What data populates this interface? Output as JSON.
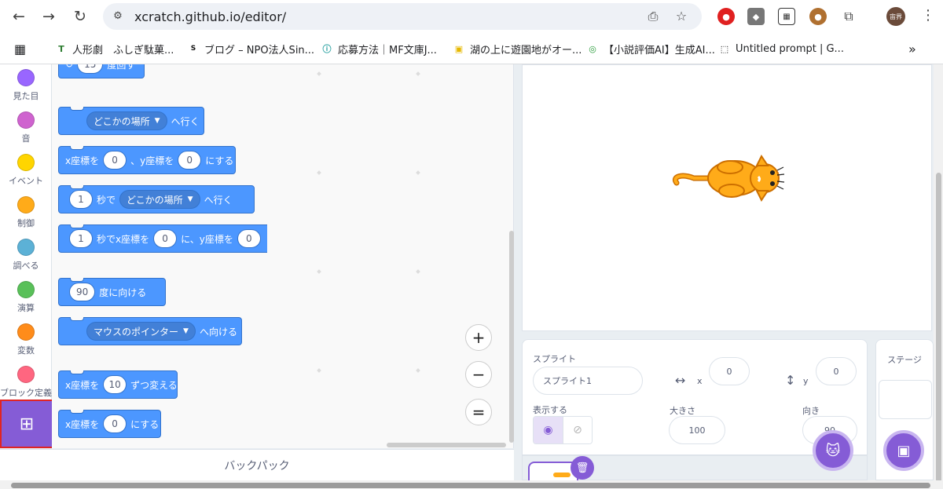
{
  "browser": {
    "url": "xcratch.github.io/editor/",
    "bookmarks": [
      {
        "label": "人形劇　ふしぎ駄菓...",
        "icon": "T"
      },
      {
        "label": "ブログ – NPO法人Sin...",
        "icon": "S"
      },
      {
        "label": "応募方法｜MF文庫J...",
        "icon": "ⓘ"
      },
      {
        "label": "湖の上に遊園地がオー...",
        "icon": "▣"
      },
      {
        "label": "【小説評価AI】生成AI...",
        "icon": "◎"
      },
      {
        "label": "Untitled prompt | G...",
        "icon": "⬚"
      }
    ],
    "more": "»",
    "avatar": "宙界"
  },
  "categories": [
    {
      "label": "見た目",
      "color": "#9966ff"
    },
    {
      "label": "音",
      "color": "#cf63cf"
    },
    {
      "label": "イベント",
      "color": "#ffd500"
    },
    {
      "label": "制御",
      "color": "#ffab19"
    },
    {
      "label": "調べる",
      "color": "#5cb1d6"
    },
    {
      "label": "演算",
      "color": "#59c059"
    },
    {
      "label": "変数",
      "color": "#ff8c1a"
    },
    {
      "label": "ブロック定義",
      "color": "#ff6680"
    }
  ],
  "blocks": {
    "b0": {
      "value": "15",
      "text": "度回す"
    },
    "b1": {
      "dd": "どこかの場所",
      "text": "へ行く"
    },
    "b2": {
      "t1": "x座標を",
      "v1": "0",
      "t2": "、y座標を",
      "v2": "0",
      "t3": "にする"
    },
    "b3": {
      "v1": "1",
      "t1": "秒で",
      "dd": "どこかの場所",
      "t2": "へ行く"
    },
    "b4": {
      "v1": "1",
      "t1": "秒でx座標を",
      "v2": "0",
      "t2": "に、y座標を",
      "v3": "0"
    },
    "b5": {
      "v1": "90",
      "t1": "度に向ける"
    },
    "b6": {
      "dd": "マウスのポインター",
      "t1": "へ向ける"
    },
    "b7": {
      "t1": "x座標を",
      "v1": "10",
      "t2": "ずつ変える"
    },
    "b8": {
      "t1": "x座標を",
      "v1": "0",
      "t2": "にする"
    }
  },
  "zoom": {
    "in": "+",
    "out": "−",
    "reset": "="
  },
  "backpack": "バックパック",
  "sprite": {
    "label": "スプライト",
    "name": "スプライト1",
    "x_label": "x",
    "x": "0",
    "y_label": "y",
    "y": "0",
    "show_label": "表示する",
    "size_label": "大きさ",
    "size": "100",
    "direction_label": "向き",
    "direction": "90"
  },
  "stage_pane": {
    "label": "ステージ"
  }
}
